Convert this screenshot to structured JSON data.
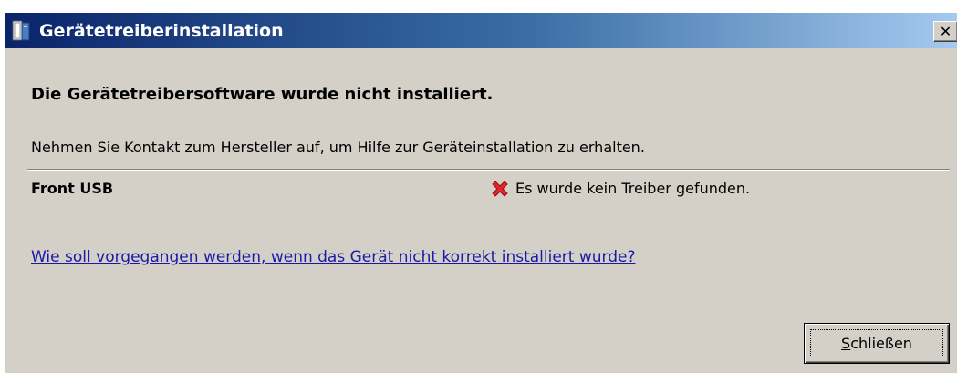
{
  "window": {
    "title": "Gerätetreiberinstallation",
    "close_glyph": "✕"
  },
  "content": {
    "heading": "Die Gerätetreibersoftware wurde nicht installiert.",
    "info": "Nehmen Sie Kontakt zum Hersteller auf, um Hilfe zur Geräteinstallation zu erhalten.",
    "device": {
      "name": "Front USB",
      "status_icon": "error-x-icon",
      "status": "Es wurde kein Treiber gefunden."
    },
    "help_link": "Wie soll vorgegangen werden, wenn das Gerät nicht korrekt installiert wurde?"
  },
  "buttons": {
    "close_accel": "S",
    "close_rest": "chließen"
  },
  "colors": {
    "title_gradient_start": "#0a246a",
    "title_gradient_end": "#a6caf0",
    "dialog_background": "#d4d0c8",
    "link": "#1a1aa8",
    "error": "#e0262a"
  }
}
